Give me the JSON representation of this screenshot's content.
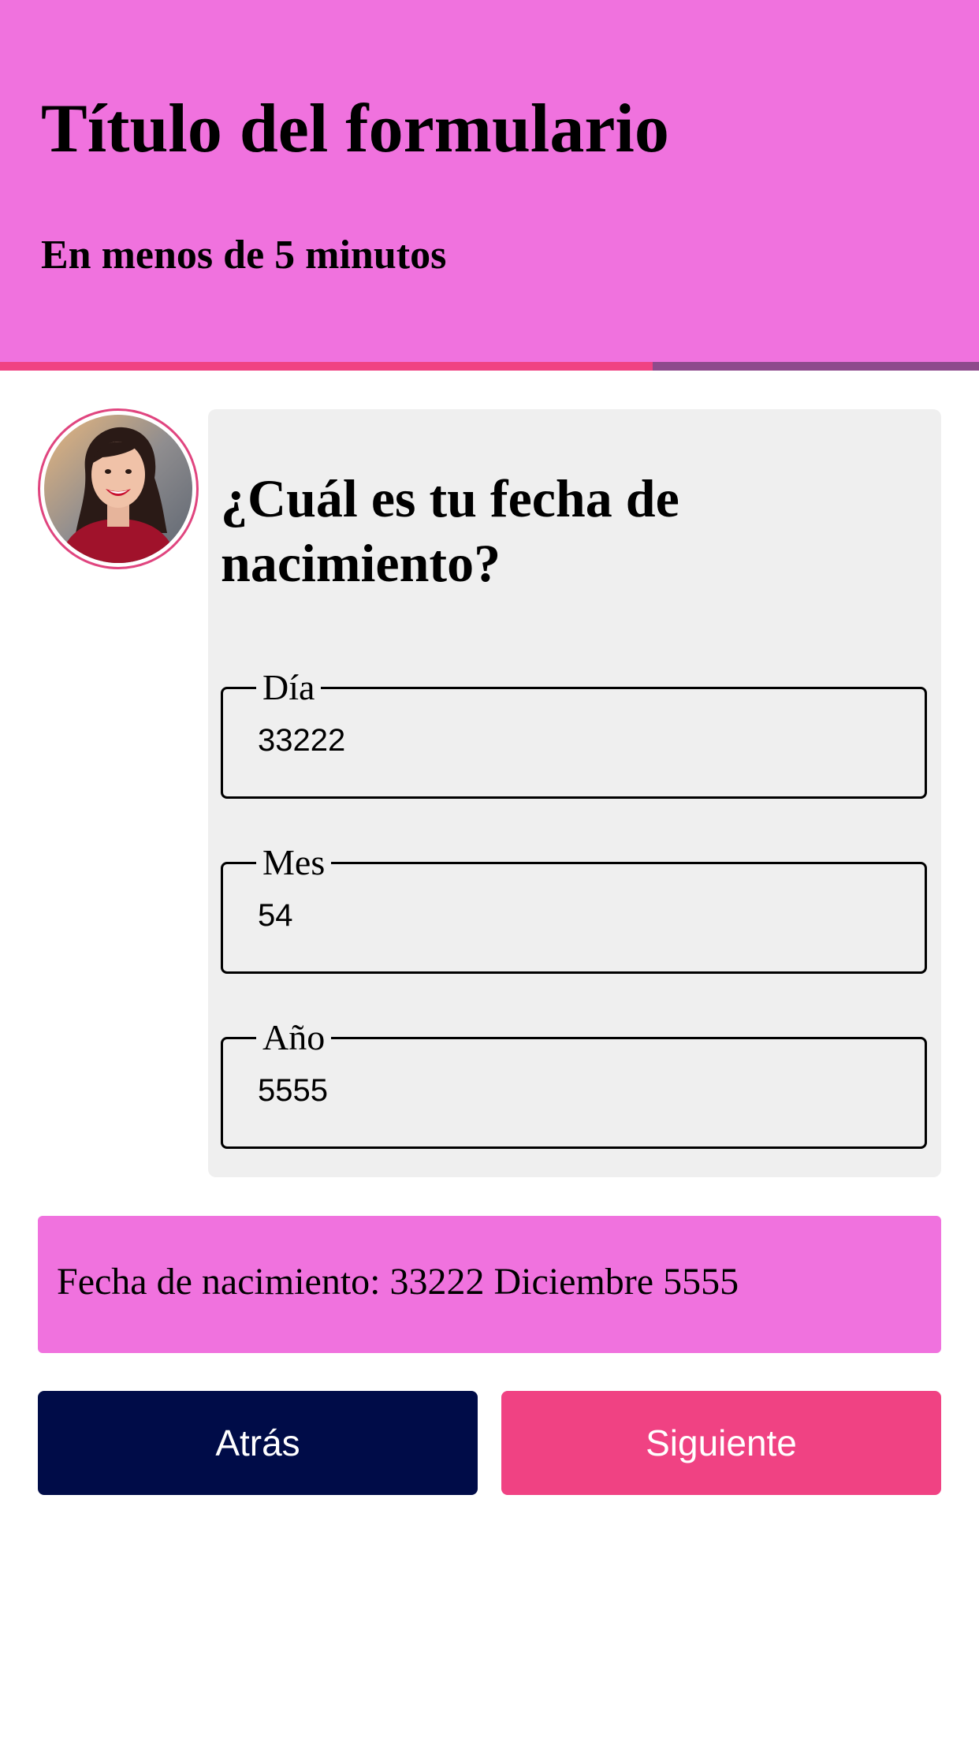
{
  "header": {
    "title": "Título del formulario",
    "subtitle": "En menos de 5 minutos",
    "background_color": "#f072de"
  },
  "progress": {
    "fraction": 0.667,
    "fill_color": "#f04283",
    "track_color": "#8e4a8c"
  },
  "avatar": {
    "icon": "person-photo",
    "ring_color": "#e0457f"
  },
  "question": {
    "text": "¿Cuál es tu fecha de nacimiento?"
  },
  "fields": {
    "day": {
      "label": "Día",
      "value": "33222"
    },
    "month": {
      "label": "Mes",
      "value": "54"
    },
    "year": {
      "label": "Año",
      "value": "5555"
    }
  },
  "summary": {
    "text": "Fecha de nacimiento: 33222 Diciembre 5555",
    "background_color": "#f072de"
  },
  "buttons": {
    "back": {
      "label": "Atrás",
      "color": "#000c48"
    },
    "next": {
      "label": "Siguiente",
      "color": "#f04283"
    }
  }
}
